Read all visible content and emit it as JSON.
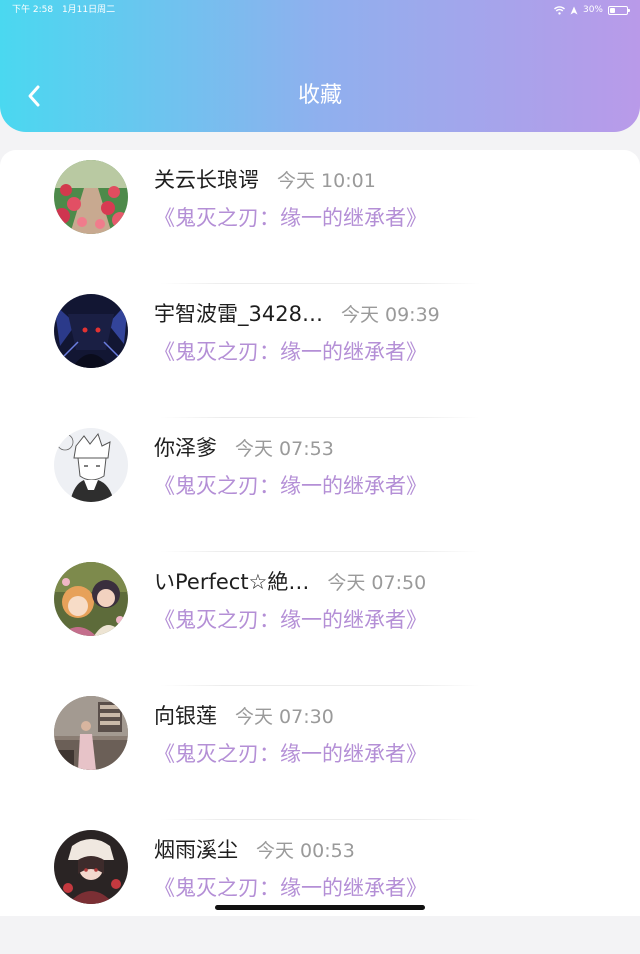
{
  "status_bar": {
    "time": "下午 2:58",
    "date": "1月11日周二",
    "battery": "30%",
    "battery_level": 0.3,
    "icons": [
      "wifi-icon",
      "location-icon",
      "battery-icon"
    ]
  },
  "header": {
    "title": "收藏",
    "back_icon": "chevron-left-icon",
    "gradient": [
      "#4ad8f0",
      "#8fb0ee",
      "#b99ae9"
    ]
  },
  "colors": {
    "accent": "#b48fd6",
    "name": "#1e1e1e",
    "time": "#9a9a9a"
  },
  "favorites": [
    {
      "name": "关云长琅谔",
      "time": "今天 10:01",
      "title": "《鬼灭之刃：缘一的继承者》",
      "avatar": "flower-path-avatar"
    },
    {
      "name": "宇智波雷_3428…",
      "time": "今天 09:39",
      "title": "《鬼灭之刃：缘一的继承者》",
      "avatar": "dark-anime-avatar"
    },
    {
      "name": "你泽爹",
      "time": "今天 07:53",
      "title": "《鬼灭之刃：缘一的继承者》",
      "avatar": "sketch-anime-avatar"
    },
    {
      "name": "いPerfect☆絶…",
      "time": "今天 07:50",
      "title": "《鬼灭之刃：缘一的继承者》",
      "avatar": "anime-girls-avatar"
    },
    {
      "name": "向银莲",
      "time": "今天 07:30",
      "title": "《鬼灭之刃：缘一的继承者》",
      "avatar": "photo-room-avatar"
    },
    {
      "name": "烟雨溪尘",
      "time": "今天 00:53",
      "title": "《鬼灭之刃：缘一的继承者》",
      "avatar": "dark-portrait-avatar"
    }
  ]
}
